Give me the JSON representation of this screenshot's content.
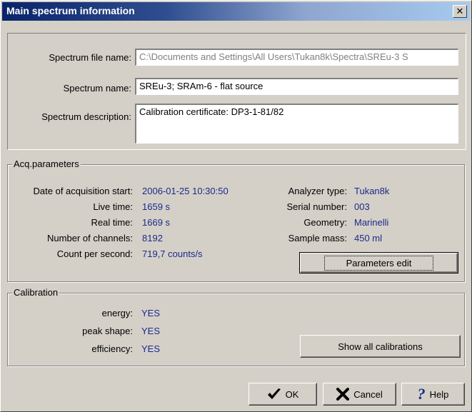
{
  "window": {
    "title": "Main spectrum information"
  },
  "file": {
    "file_name_label": "Spectrum file name:",
    "file_name_value": "C:\\Documents and Settings\\All Users\\Tukan8k\\Spectra\\SREu-3 S",
    "name_label": "Spectrum name:",
    "name_value": "SREu-3; SRAm-6 - flat source",
    "description_label": "Spectrum description:",
    "description_value": "Calibration certificate: DP3-1-81/82"
  },
  "acq": {
    "title": "Acq.parameters",
    "left": [
      {
        "label": "Date of acquisition start:",
        "value": "2006-01-25 10:30:50"
      },
      {
        "label": "Live time:",
        "value": "1659 s"
      },
      {
        "label": "Real time:",
        "value": "1669 s"
      },
      {
        "label": "Number of channels:",
        "value": "8192"
      },
      {
        "label": "Count per second:",
        "value": "719,7 counts/s"
      }
    ],
    "right": [
      {
        "label": "Analyzer type:",
        "value": "Tukan8k"
      },
      {
        "label": "Serial number:",
        "value": "003"
      },
      {
        "label": "Geometry:",
        "value": "Marinelli"
      },
      {
        "label": "Sample mass:",
        "value": "450  ml"
      }
    ],
    "params_button": "Parameters edit"
  },
  "calibration": {
    "title": "Calibration",
    "items": [
      {
        "label": "energy:",
        "value": "YES"
      },
      {
        "label": "peak shape:",
        "value": "YES"
      },
      {
        "label": "efficiency:",
        "value": "YES"
      }
    ],
    "show_all_button": "Show all calibrations"
  },
  "buttons": {
    "ok": "OK",
    "cancel": "Cancel",
    "help": "Help"
  },
  "colors": {
    "value_text": "#1a2a8a",
    "title_bar": "#0a246a"
  }
}
